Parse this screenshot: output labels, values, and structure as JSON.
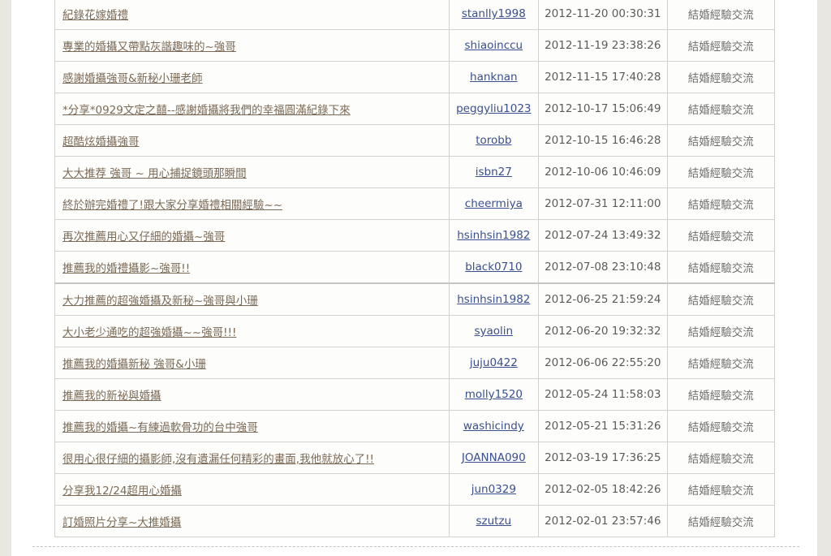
{
  "posts": [
    {
      "title": "紀錄花嫁婚禮",
      "author": "stanlly1998",
      "date": "2012-11-20 00:30:31",
      "category": "結婚經驗交流"
    },
    {
      "title": "專業的婚攝又帶點灰諧趣味的~強哥",
      "author": "shiaoinccu",
      "date": "2012-11-19 23:38:26",
      "category": "結婚經驗交流"
    },
    {
      "title": "感謝婚攝強哥&新秘小珊老師",
      "author": "hanknan",
      "date": "2012-11-15 17:40:28",
      "category": "結婚經驗交流"
    },
    {
      "title": "*分享*0929文定之囍--感謝婚攝將我們的幸福圓滿紀錄下來",
      "author": "peggyliu1023",
      "date": "2012-10-17 15:06:49",
      "category": "結婚經驗交流"
    },
    {
      "title": "超酷炫婚攝強哥",
      "author": "torobb",
      "date": "2012-10-15 16:46:28",
      "category": "結婚經驗交流"
    },
    {
      "title": "大大推荐 強哥 ~ 用心捕捉鏡頭那瞬間",
      "author": "isbn27",
      "date": "2012-10-06 10:46:09",
      "category": "結婚經驗交流"
    },
    {
      "title": "終於辦完婚禮了!跟大家分享婚禮相關經驗~~",
      "author": "cheermiya",
      "date": "2012-07-31 12:11:00",
      "category": "結婚經驗交流"
    },
    {
      "title": "再次推薦用心又仔細的婚攝~強哥",
      "author": "hsinhsin1982",
      "date": "2012-07-24 13:49:32",
      "category": "結婚經驗交流"
    },
    {
      "title": "推薦我的婚禮攝影~強哥!!",
      "author": "black0710",
      "date": "2012-07-08 23:10:48",
      "category": "結婚經驗交流"
    },
    {
      "title": "大力推薦的超強婚攝及新秘~強哥與小珊",
      "author": "hsinhsin1982",
      "date": "2012-06-25 21:59:24",
      "category": "結婚經驗交流"
    },
    {
      "title": "大小老少通吃的超強婚攝~~強哥!!!",
      "author": "syaolin",
      "date": "2012-06-20 19:32:32",
      "category": "結婚經驗交流"
    },
    {
      "title": "推薦我的婚攝新秘  強哥&小珊",
      "author": "juju0422",
      "date": "2012-06-06 22:55:20",
      "category": "結婚經驗交流"
    },
    {
      "title": "推薦我的新祕與婚攝",
      "author": "molly1520",
      "date": "2012-05-24 11:58:03",
      "category": "結婚經驗交流"
    },
    {
      "title": "推薦我的婚攝~有練過軟骨功的台中強哥",
      "author": "washicindy",
      "date": "2012-05-21 15:31:26",
      "category": "結婚經驗交流"
    },
    {
      "title": "很用心很仔細的攝影師,沒有遺漏任何精彩的畫面,我他就放心了!!",
      "author": "JOANNA090",
      "date": "2012-03-19 17:36:25",
      "category": "結婚經驗交流"
    },
    {
      "title": "分享我12/24超用心婚攝",
      "author": "jun0329",
      "date": "2012-02-05 18:42:26",
      "category": "結婚經驗交流"
    },
    {
      "title": "訂婚照片分享~大推婚攝",
      "author": "szutzu",
      "date": "2012-02-01 23:57:46",
      "category": "結婚經驗交流"
    }
  ]
}
